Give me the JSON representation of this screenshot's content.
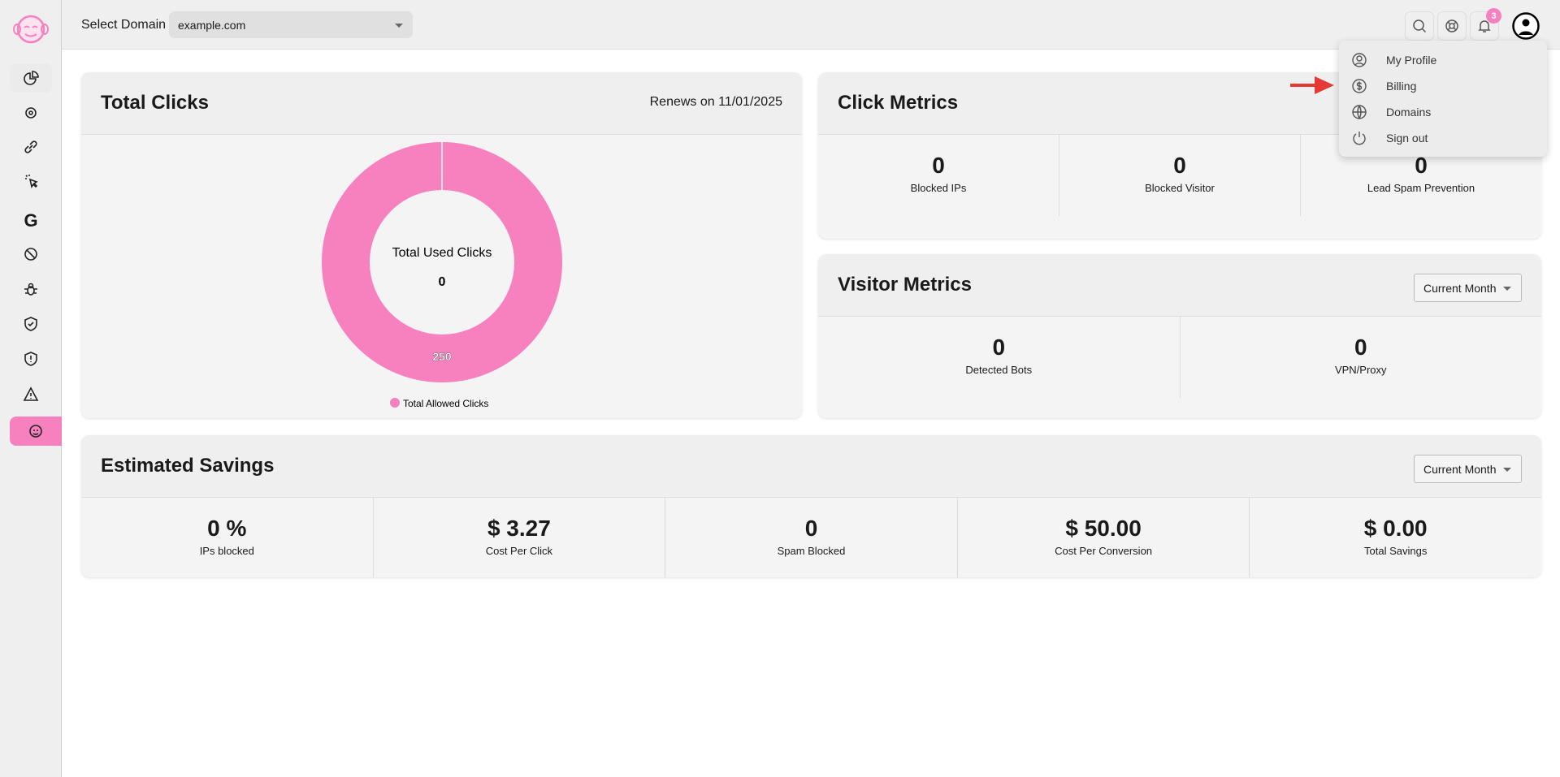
{
  "header": {
    "select_label": "Select Domain",
    "domain": "example.com",
    "notifications": "3"
  },
  "user_menu": {
    "items": [
      "My Profile",
      "Billing",
      "Domains",
      "Sign out"
    ]
  },
  "total_clicks": {
    "title": "Total Clicks",
    "renews": "Renews on 11/01/2025",
    "center_label": "Total Used Clicks",
    "center_value": "0",
    "legend": "Total Allowed Clicks",
    "slice_label": "250"
  },
  "chart_data": {
    "type": "pie",
    "categories": [
      "Total Allowed Clicks"
    ],
    "values": [
      250
    ],
    "colors": [
      "#f780bf"
    ],
    "center_label": "Total Used Clicks",
    "center_value": 0,
    "legend": "bottom"
  },
  "click_metrics": {
    "title": "Click Metrics",
    "items": [
      {
        "value": "0",
        "label": "Blocked IPs"
      },
      {
        "value": "0",
        "label": "Blocked Visitor"
      },
      {
        "value": "0",
        "label": "Lead Spam Prevention"
      }
    ]
  },
  "visitor_metrics": {
    "title": "Visitor Metrics",
    "period": "Current Month",
    "items": [
      {
        "value": "0",
        "label": "Detected Bots"
      },
      {
        "value": "0",
        "label": "VPN/Proxy"
      }
    ]
  },
  "savings": {
    "title": "Estimated Savings",
    "period": "Current Month",
    "items": [
      {
        "value": "0 %",
        "label": "IPs blocked"
      },
      {
        "value": "$ 3.27",
        "label": "Cost Per Click"
      },
      {
        "value": "0",
        "label": "Spam Blocked"
      },
      {
        "value": "$ 50.00",
        "label": "Cost Per Conversion"
      },
      {
        "value": "$ 0.00",
        "label": "Total Savings"
      }
    ]
  },
  "colors": {
    "accent": "#f780bf",
    "arrow": "#e53935"
  }
}
